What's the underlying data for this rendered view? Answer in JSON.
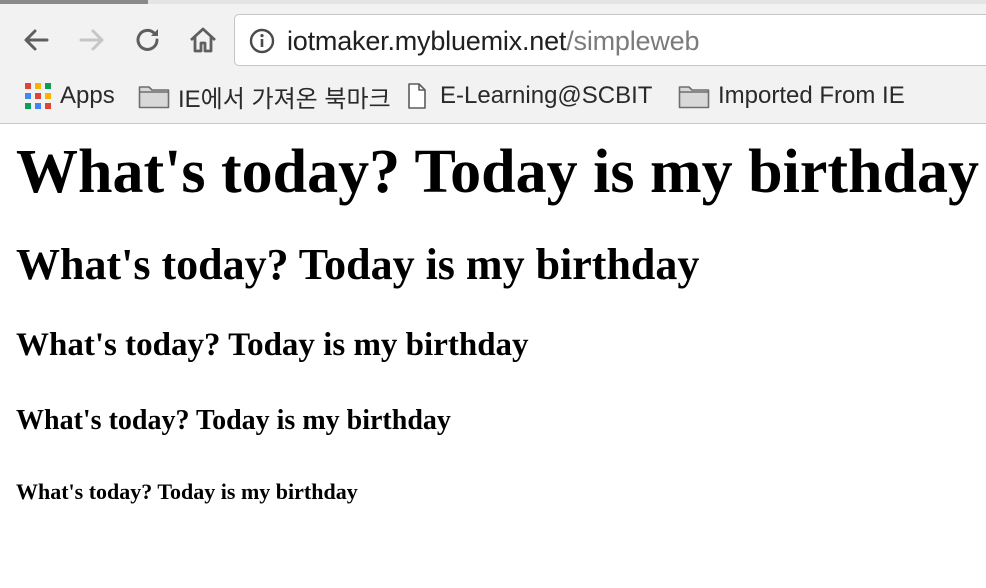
{
  "browser": {
    "url_host": "iotmaker.mybluemix.net",
    "url_path": "/simpleweb"
  },
  "icons": {
    "back": "back-arrow-icon",
    "forward": "forward-arrow-icon",
    "reload": "reload-icon",
    "home": "home-icon",
    "info": "info-icon",
    "apps": "apps-grid-icon",
    "folder": "folder-icon",
    "page": "page-icon"
  },
  "bookmarks": [
    {
      "label": "Apps",
      "icon": "apps-grid-icon"
    },
    {
      "label": "IE에서 가져온 북마크",
      "icon": "folder-icon"
    },
    {
      "label": "E-Learning@SCBIT",
      "icon": "page-icon"
    },
    {
      "label": "Imported From IE",
      "icon": "folder-icon"
    }
  ],
  "content": {
    "h1": "What's today? Today is my birthday",
    "h2": "What's today? Today is my birthday",
    "h3": "What's today? Today is my birthday",
    "h4": "What's today? Today is my birthday",
    "h5": "What's today? Today is my birthday"
  },
  "colors": {
    "chrome_bg": "#f2f2f2",
    "url_host": "#202020",
    "url_path": "#7b7b7b",
    "apps_grid": [
      "#db4437",
      "#f4b400",
      "#0f9d58",
      "#4285f4"
    ]
  }
}
